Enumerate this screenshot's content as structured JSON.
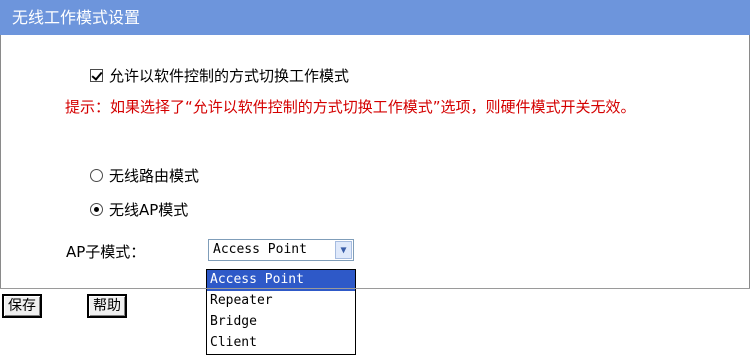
{
  "header": {
    "title": "无线工作模式设置"
  },
  "software_control": {
    "label": "允许以软件控制的方式切换工作模式",
    "checked": true
  },
  "hint": "提示：如果选择了“允许以软件控制的方式切换工作模式”选项，则硬件模式开关无效。",
  "modes": [
    {
      "label": "无线路由模式",
      "selected": false
    },
    {
      "label": "无线AP模式",
      "selected": true
    }
  ],
  "ap_submode": {
    "label": "AP子模式：",
    "value": "Access Point",
    "options": [
      "Access Point",
      "Repeater",
      "Bridge",
      "Client"
    ]
  },
  "buttons": {
    "save": "保存",
    "help": "帮助"
  }
}
